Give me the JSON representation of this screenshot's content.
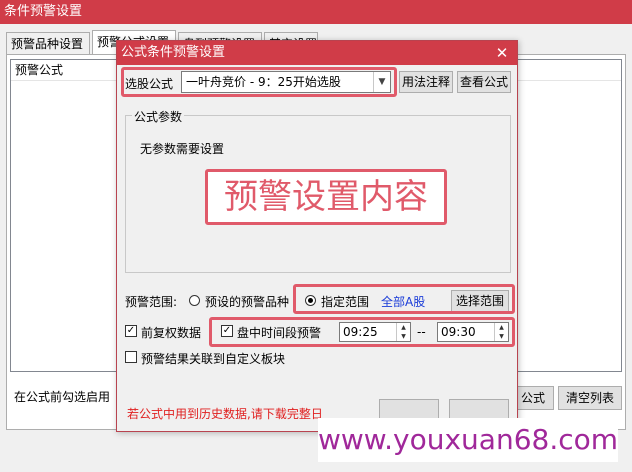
{
  "window": {
    "title": "条件预警设置",
    "tabs": [
      "预警品种设置",
      "预警公式设置",
      "盘到预警设置",
      "其它设置"
    ],
    "list_header": "预警公式",
    "bottom_text": "在公式前勾选启用",
    "btn_formula": "公式",
    "btn_clear": "清空列表"
  },
  "dialog": {
    "title": "公式条件预警设置",
    "select_label": "选股公式",
    "formula_value": "一叶舟竞价  - 9：25开始选股",
    "btn_usage": "用法注释",
    "btn_view": "查看公式",
    "params_group": "公式参数",
    "params_text": "无参数需要设置",
    "overlay_label": "预警设置内容",
    "range_label": "预警范围:",
    "radio_preset": "预设的预警品种",
    "radio_specified": "指定范围",
    "range_value": "全部A股",
    "btn_select_range": "选择范围",
    "chk_fuquan": "前复权数据",
    "chk_period": "盘中时间段预警",
    "time_from": "09:25",
    "time_sep": "--",
    "time_to": "09:30",
    "chk_link": "预警结果关联到自定义板块",
    "warning": "若公式中用到历史数据,请下载完整日"
  },
  "watermark": "www.youxuan68.com",
  "colors": {
    "titlebar": "#d03c48",
    "highlight": "#e05a6a",
    "warning": "#e02020",
    "link": "#1a3cd8"
  }
}
